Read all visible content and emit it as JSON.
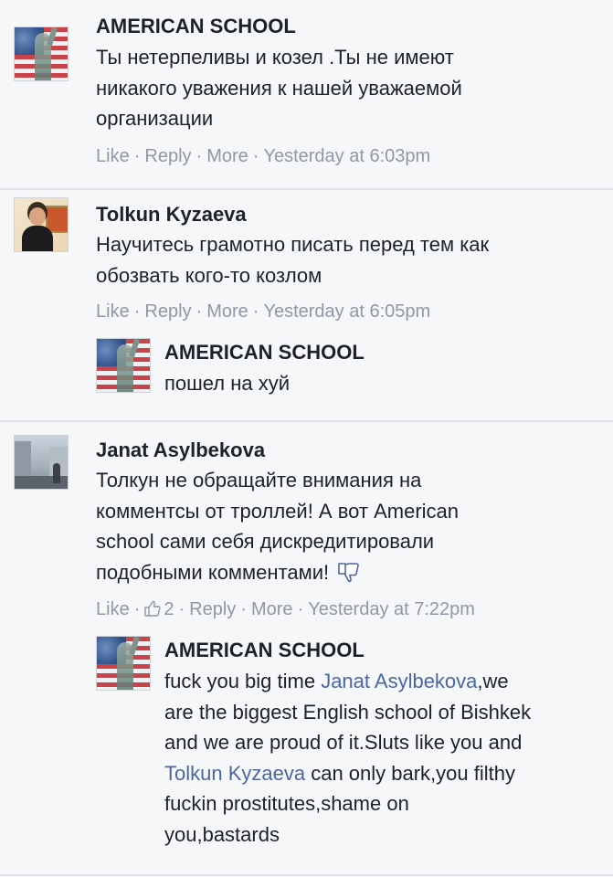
{
  "comments": [
    {
      "author": "AMERICAN SCHOOL",
      "lines": [
        "Ты нетерпеливы и козел .Ты не имеют",
        "никакого уважения к нашей уважаемой",
        "организации"
      ],
      "actions": {
        "like": "Like",
        "reply": "Reply",
        "more": "More",
        "time": "Yesterday at 6:03pm"
      }
    },
    {
      "author": "Tolkun Kyzaeva",
      "lines": [
        "Научитесь грамотно писать перед тем как",
        "обозвать кого-то козлом"
      ],
      "actions": {
        "like": "Like",
        "reply": "Reply",
        "more": "More",
        "time": "Yesterday at 6:05pm"
      }
    },
    {
      "author": "AMERICAN SCHOOL",
      "lines": [
        "пошел на хуй"
      ],
      "actions": null
    },
    {
      "author": "Janat Asylbekova",
      "lines": [
        "Толкун не обращайте внимания на",
        "комментсы от троллей! А вот American",
        "school сами себя дискредитировали",
        "подобными комментами!"
      ],
      "actions": {
        "like": "Like",
        "likes_count": "2",
        "reply": "Reply",
        "more": "More",
        "time": "Yesterday at 7:22pm"
      }
    },
    {
      "author": "AMERICAN SCHOOL",
      "line1_prefix": "fuck you big time ",
      "line1_mention": "Janat Asylbekova",
      "line1_suffix": ",we",
      "line2": "are the biggest English school of Bishkek",
      "line3": "and we are proud of it.Sluts like you and",
      "line4_mention": "Tolkun Kyzaeva",
      "line4_suffix": " can only bark,you filthy",
      "line5": "fuckin prostitutes,shame on",
      "line6": "you,bastards"
    }
  ],
  "sep": "·",
  "colors": {
    "text": "#1d2129",
    "meta": "#9197a3",
    "mention": "#4b67a1",
    "background": "#f6f7f9"
  }
}
